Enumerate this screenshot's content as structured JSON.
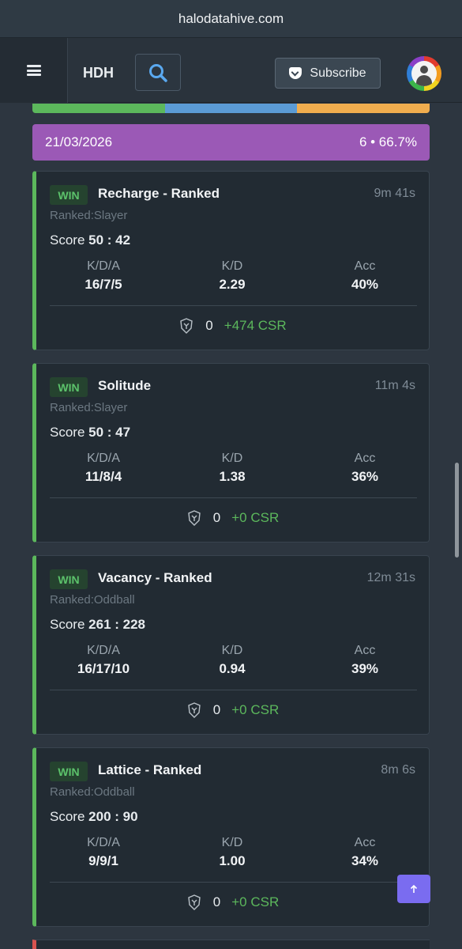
{
  "browser": {
    "url": "halodatahive.com"
  },
  "navbar": {
    "brand": "HDH",
    "subscribe_label": "Subscribe",
    "icons": [
      "menu-icon",
      "search-icon",
      "pocket-icon",
      "avatar"
    ]
  },
  "session": {
    "colors": [
      "#5cb85c",
      "#5b9bd5",
      "#f0ad4e"
    ],
    "date": "21/03/2026",
    "summary": "6 • 66.7%",
    "accent": "#9b59b6"
  },
  "matches": [
    {
      "result": "WIN",
      "map": "Recharge - Ranked",
      "duration": "9m 41s",
      "mode": "Ranked:Slayer",
      "score_label": "Score",
      "score": "50 : 42",
      "kda_label": "K/D/A",
      "kda": "16/7/5",
      "kd_label": "K/D",
      "kd": "2.29",
      "acc_label": "Acc",
      "acc": "40%",
      "kills": "0",
      "csr": "+474 CSR"
    },
    {
      "result": "WIN",
      "map": "Solitude",
      "duration": "11m 4s",
      "mode": "Ranked:Slayer",
      "score_label": "Score",
      "score": "50 : 47",
      "kda_label": "K/D/A",
      "kda": "11/8/4",
      "kd_label": "K/D",
      "kd": "1.38",
      "acc_label": "Acc",
      "acc": "36%",
      "kills": "0",
      "csr": "+0 CSR"
    },
    {
      "result": "WIN",
      "map": "Vacancy - Ranked",
      "duration": "12m 31s",
      "mode": "Ranked:Oddball",
      "score_label": "Score",
      "score": "261 : 228",
      "kda_label": "K/D/A",
      "kda": "16/17/10",
      "kd_label": "K/D",
      "kd": "0.94",
      "acc_label": "Acc",
      "acc": "39%",
      "kills": "0",
      "csr": "+0 CSR"
    },
    {
      "result": "WIN",
      "map": "Lattice - Ranked",
      "duration": "8m 6s",
      "mode": "Ranked:Oddball",
      "score_label": "Score",
      "score": "200 : 90",
      "kda_label": "K/D/A",
      "kda": "9/9/1",
      "kd_label": "K/D",
      "kd": "1.00",
      "acc_label": "Acc",
      "acc": "34%",
      "kills": "0",
      "csr": "+0 CSR"
    }
  ],
  "scroll_top_icon": "arrow-up-icon"
}
